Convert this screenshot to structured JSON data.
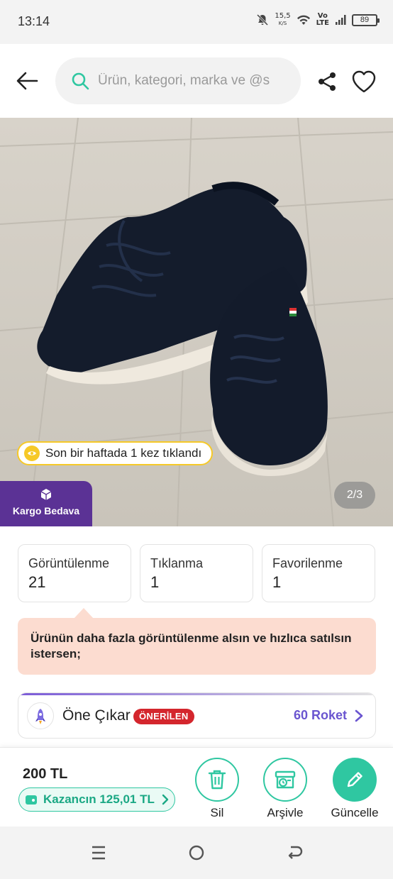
{
  "status_bar": {
    "time": "13:14",
    "network_speed_value": "15,5",
    "network_speed_unit": "K/S",
    "volte_top": "Vo",
    "volte_bottom": "LTE",
    "battery": "89"
  },
  "header": {
    "search_placeholder": "Ürün, kategori, marka ve @s",
    "icons": [
      "back-arrow-icon",
      "search-icon",
      "share-icon",
      "heart-icon"
    ]
  },
  "product_image": {
    "click_badge": "Son bir haftada 1 kez tıklandı",
    "cargo_badge": "Kargo Bedava",
    "page_indicator": "2/3"
  },
  "stats": [
    {
      "label": "Görüntülenme",
      "value": "21"
    },
    {
      "label": "Tıklanma",
      "value": "1"
    },
    {
      "label": "Favorilenme",
      "value": "1"
    }
  ],
  "promo": {
    "text": "Ürünün daha fazla görüntülenme alsın ve hızlıca satılsın istersen;"
  },
  "feature": {
    "title": "Öne Çıkar",
    "badge": "ÖNERİLEN",
    "price": "60 Roket"
  },
  "bottom_bar": {
    "price": "200 TL",
    "earnings": "Kazancın 125,01 TL",
    "actions": [
      {
        "label": "Sil",
        "icon": "trash-icon"
      },
      {
        "label": "Arşivle",
        "icon": "archive-icon"
      },
      {
        "label": "Güncelle",
        "icon": "pencil-icon"
      }
    ]
  },
  "colors": {
    "accent_green": "#2fc7a1",
    "cargo_purple": "#5b3295",
    "promo_bg": "#fcdcd0",
    "recommended_red": "#d4262d",
    "rocket_purple": "#6a55d0",
    "badge_yellow": "#f6c928"
  }
}
